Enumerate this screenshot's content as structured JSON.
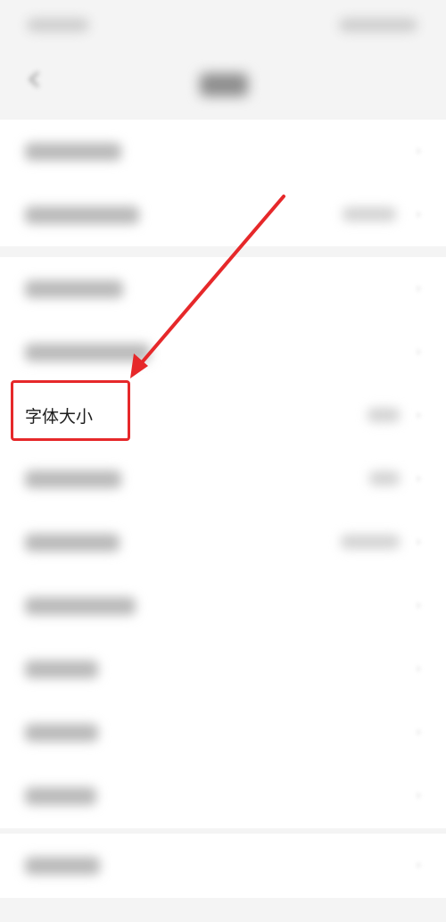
{
  "settings": {
    "font_size_label": "字体大小"
  },
  "icons": {
    "back": "arrow-left-icon",
    "chevron": "chevron-right-icon"
  },
  "colors": {
    "highlight": "#e6282a",
    "page_background": "#f4f4f4",
    "row_background": "#ffffff"
  }
}
